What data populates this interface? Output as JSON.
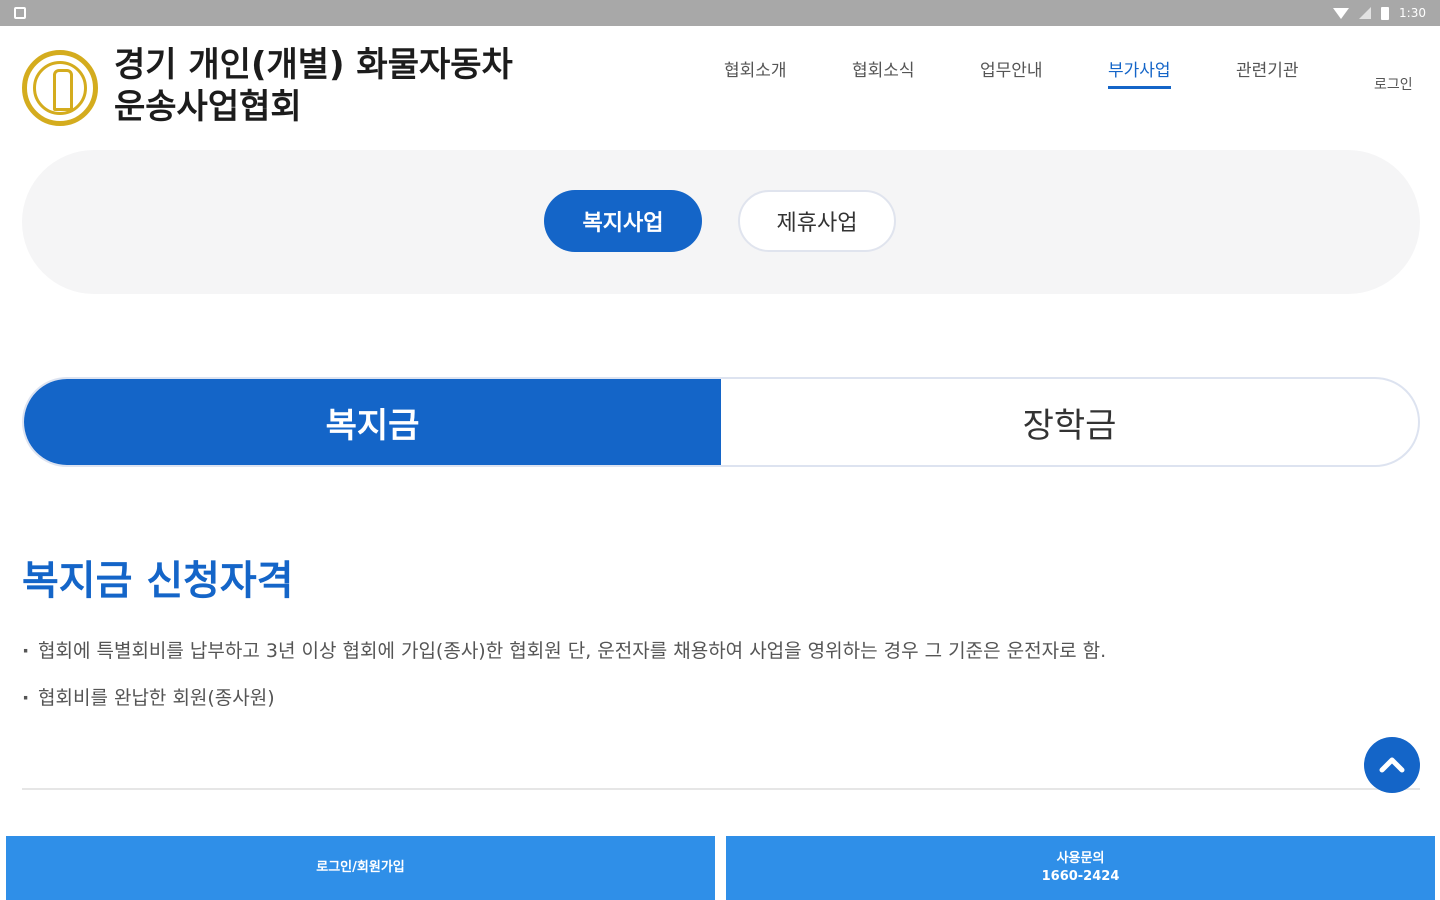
{
  "status_bar": {
    "time": "1:30"
  },
  "header": {
    "org_title_line1": "경기 개인(개별) 화물자동차",
    "org_title_line2": "운송사업협회",
    "nav": [
      {
        "label": "협회소개"
      },
      {
        "label": "협회소식"
      },
      {
        "label": "업무안내"
      },
      {
        "label": "부가사업"
      },
      {
        "label": "관련기관"
      },
      {
        "label": "로그인"
      }
    ]
  },
  "sub_tabs": {
    "active": "복지사업",
    "inactive": "제휴사업"
  },
  "main_tabs": {
    "active": "복지금",
    "inactive": "장학금"
  },
  "section": {
    "title": "복지금 신청자격",
    "items": [
      "협회에 특별회비를 납부하고 3년 이상 협회에 가입(종사)한 협회원 단, 운전자를 채용하여 사업을 영위하는 경우 그 기준은 운전자로 함.",
      "협회비를 완납한 회원(종사원)"
    ]
  },
  "bottom_bar": {
    "login_label": "로그인/회원가입",
    "contact_label": "사용문의",
    "contact_number": "1660-2424"
  },
  "colors": {
    "primary": "#1465c8",
    "bottom_button": "#2f8fe8",
    "logo_gold": "#d4ac1e"
  }
}
